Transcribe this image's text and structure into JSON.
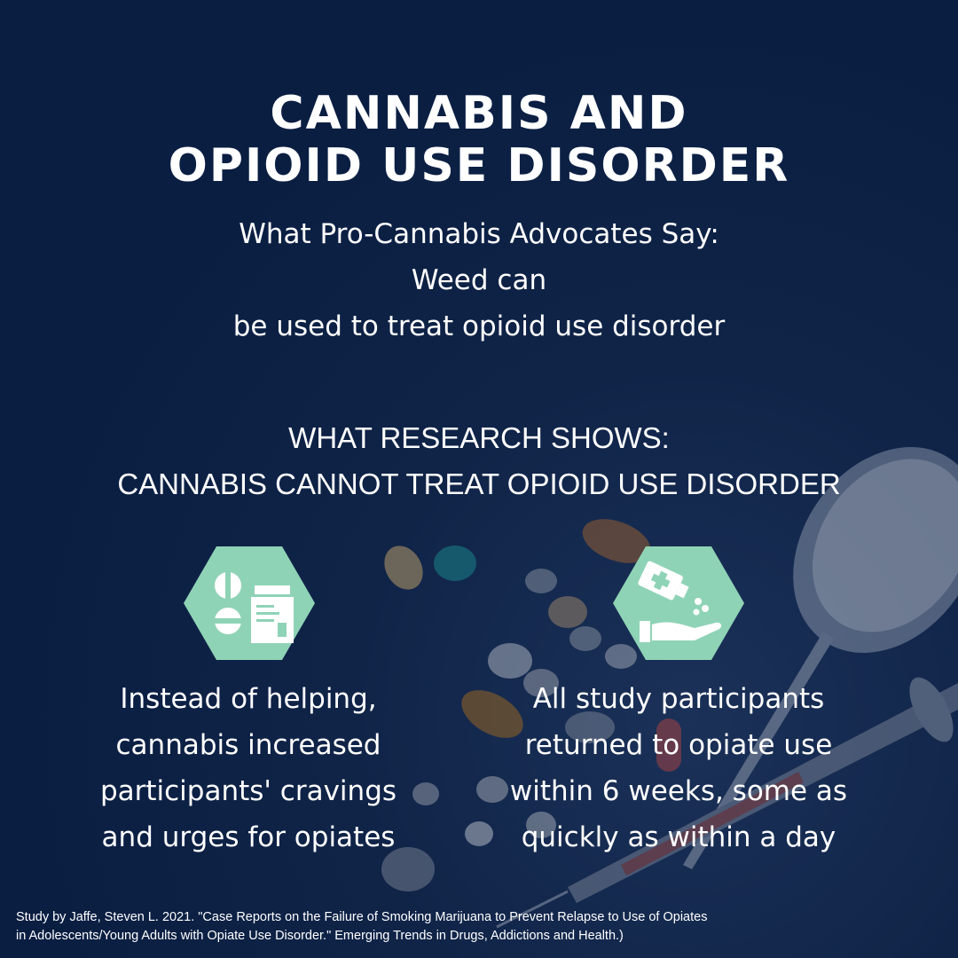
{
  "title": {
    "line1": "CANNABIS AND",
    "line2": "OPIOID USE DISORDER"
  },
  "claim": {
    "heading": "What Pro-Cannabis Advocates Say:",
    "line1": "Weed can",
    "line2": "be used to treat opioid use disorder"
  },
  "research": {
    "heading": "WHAT RESEARCH SHOWS:",
    "statement": "CANNABIS CANNOT TREAT OPIOID USE DISORDER"
  },
  "findings": [
    {
      "icon": "pills-and-bottle-icon",
      "lines": [
        "Instead of helping,",
        "cannabis increased",
        "participants' cravings",
        "and urges for opiates"
      ]
    },
    {
      "icon": "medicine-in-hand-icon",
      "lines": [
        "All study participants",
        "returned to opiate use",
        "within 6 weeks, some as",
        "quickly as within a day"
      ]
    }
  ],
  "footer": {
    "line1": "Study by Jaffe, Steven L. 2021. \"Case Reports on the Failure of Smoking Marijuana to Prevent Relapse to Use of Opiates",
    "line2": "in Adolescents/Young Adults with Opiate Use Disorder.\" Emerging Trends in Drugs, Addictions and Health.)"
  },
  "colors": {
    "background": "#0b1f44",
    "hex_fill": "#8fd3b6",
    "text": "#ffffff"
  }
}
